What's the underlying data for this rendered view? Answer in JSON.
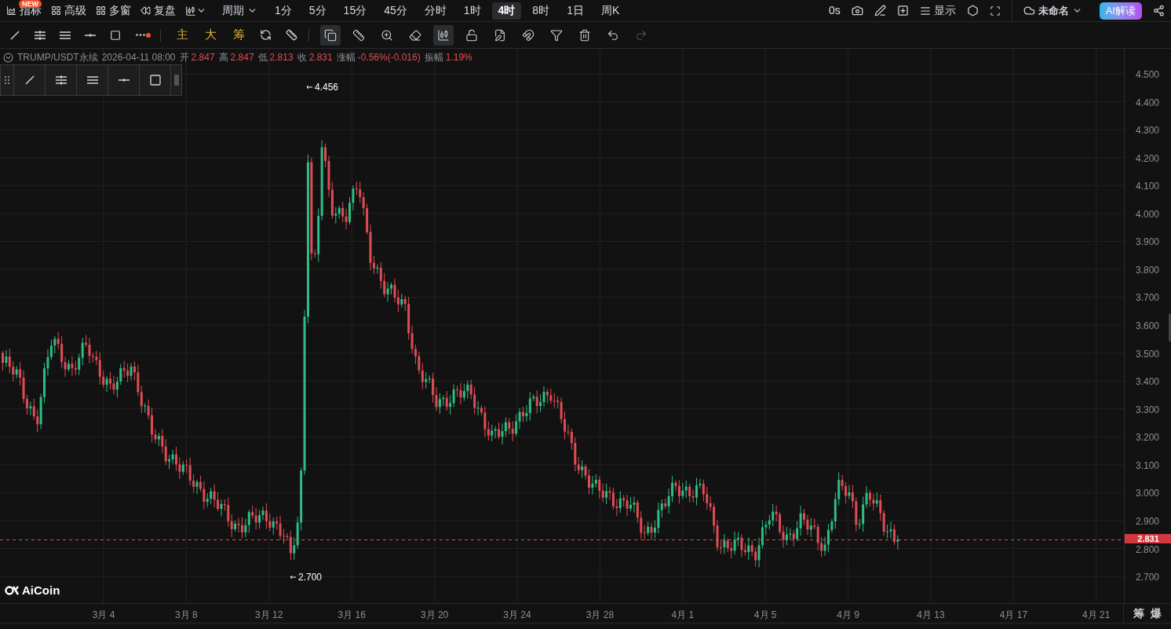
{
  "top_bar": {
    "menu": [
      {
        "kind": "indicator",
        "label": "指标",
        "badge": "NEW"
      },
      {
        "kind": "advanced",
        "label": "高级"
      },
      {
        "kind": "multi",
        "label": "多窗"
      },
      {
        "kind": "replay",
        "label": "复盘"
      }
    ],
    "period_label": "周期",
    "periods": [
      {
        "label": "1分",
        "selected": false
      },
      {
        "label": "5分",
        "selected": false
      },
      {
        "label": "15分",
        "selected": false
      },
      {
        "label": "45分",
        "selected": false
      },
      {
        "label": "分时",
        "selected": false
      },
      {
        "label": "1时",
        "selected": false
      },
      {
        "label": "4时",
        "selected": true
      },
      {
        "label": "8时",
        "selected": false
      },
      {
        "label": "1日",
        "selected": false
      },
      {
        "label": "周K",
        "selected": false
      }
    ],
    "countdown": "0s",
    "display": "显示",
    "layout_name": "未命名",
    "ai_button": "AI解读"
  },
  "draw_toolbar": {
    "text_tools": [
      "主",
      "大",
      "筹"
    ],
    "tools": [
      {
        "kind": "copy",
        "selected": true
      },
      {
        "kind": "ruler",
        "selected": false
      },
      {
        "kind": "zoom",
        "selected": false
      },
      {
        "kind": "eraser",
        "selected": false
      },
      {
        "kind": "candles",
        "selected": true
      },
      {
        "kind": "lock",
        "selected": false
      },
      {
        "kind": "note",
        "selected": false
      },
      {
        "kind": "magnet",
        "selected": false
      },
      {
        "kind": "filter",
        "selected": false
      },
      {
        "kind": "trash",
        "selected": false
      },
      {
        "kind": "undo",
        "selected": false
      },
      {
        "kind": "redo",
        "selected": false
      }
    ]
  },
  "info": {
    "symbol": "TRUMP/USDT永续",
    "time": "2026-04-11 08:00",
    "fields": [
      {
        "label": "开",
        "value": "2.847"
      },
      {
        "label": "高",
        "value": "2.847"
      },
      {
        "label": "低",
        "value": "2.813"
      },
      {
        "label": "收",
        "value": "2.831"
      },
      {
        "label": "涨幅",
        "value": "-0.56%(-0.016)"
      },
      {
        "label": "振幅",
        "value": "1.19%"
      }
    ]
  },
  "chart": {
    "y_ticks": [
      "4.500",
      "4.400",
      "4.300",
      "4.200",
      "4.100",
      "4.000",
      "3.900",
      "3.800",
      "3.700",
      "3.600",
      "3.500",
      "3.400",
      "3.300",
      "3.200",
      "3.100",
      "3.000",
      "2.900",
      "2.800",
      "2.700"
    ],
    "x_ticks": [
      "3月 4",
      "3月 8",
      "3月 12",
      "3月 16",
      "3月 20",
      "3月 24",
      "3月 28",
      "4月 1",
      "4月 5",
      "4月 9",
      "4月 13",
      "4月 17",
      "4月 21"
    ],
    "high_label": "4.456",
    "low_label": "2.700",
    "last_price": "2.831",
    "logo": "AiCoin"
  },
  "bottom_tags": [
    "筹",
    "爆"
  ]
}
